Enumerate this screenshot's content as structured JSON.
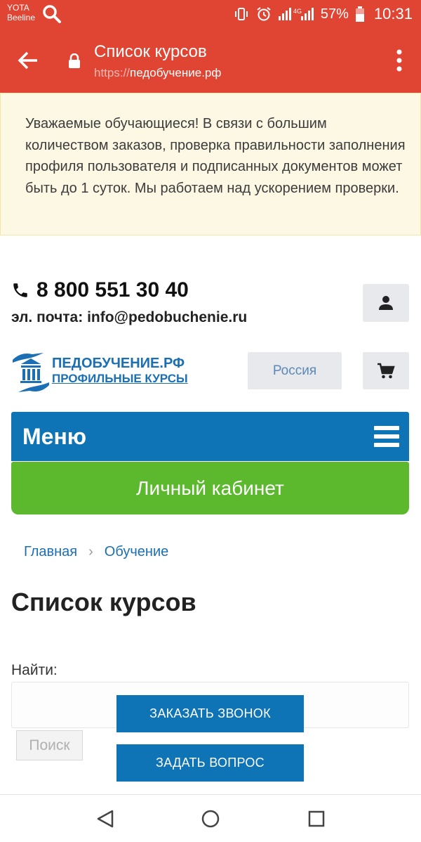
{
  "status_bar": {
    "carrier_line1": "YOTA",
    "carrier_line2": "Beeline",
    "network": "4G",
    "battery": "57%",
    "time": "10:31"
  },
  "browser": {
    "title": "Список курсов",
    "url_scheme": "https://",
    "url_host": "педобучение.рф"
  },
  "notice": {
    "text": "Уважаемые обучающиеся! В связи с большим количеством заказов, проверка правильности заполнения профиля пользователя и подписанных документов может быть до 1 суток. Мы работаем над ускорением проверки."
  },
  "contact": {
    "phone": "8 800 551 30 40",
    "email_label": "эл. почта:",
    "email": "info@pedobuchenie.ru"
  },
  "logo": {
    "name": "ПЕДОБУЧЕНИЕ.РФ",
    "tagline": "ПРОФИЛЬНЫЕ КУРСЫ"
  },
  "region": "Россия",
  "menu": {
    "label": "Меню"
  },
  "cabinet": "Личный кабинет",
  "breadcrumb": {
    "items": [
      "Главная",
      "Обучение"
    ],
    "separator": "›"
  },
  "heading": "Список курсов",
  "search": {
    "label": "Найти:",
    "value": "",
    "button": "Поиск"
  },
  "cta": {
    "call": "ЗАКАЗАТЬ ЗВОНОК",
    "question": "ЗАДАТЬ ВОПРОС"
  },
  "colors": {
    "header": "#e04534",
    "primary_blue": "#0e74b5",
    "green": "#5cb82d",
    "notice_bg": "#fcf8e3"
  },
  "icons": [
    "search-icon",
    "vibrate-icon",
    "alarm-icon",
    "signal-icon",
    "battery-icon",
    "back-arrow-icon",
    "lock-icon",
    "more-vert-icon",
    "phone-icon",
    "user-icon",
    "cart-icon",
    "hamburger-icon",
    "nav-back-icon",
    "nav-home-icon",
    "nav-recents-icon"
  ]
}
